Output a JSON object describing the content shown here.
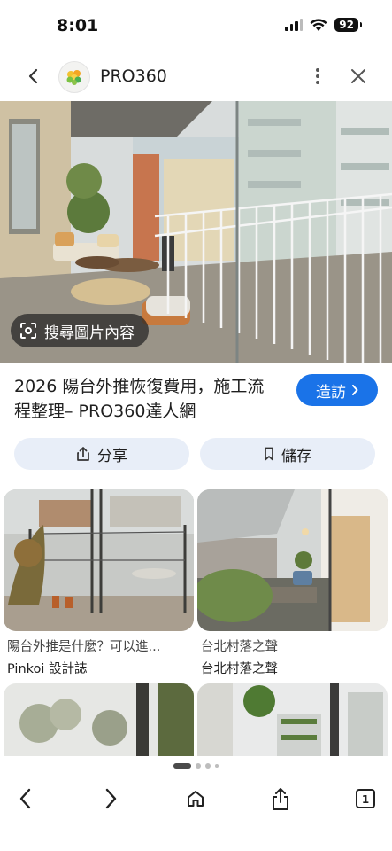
{
  "status": {
    "time": "8:01",
    "battery": "92"
  },
  "header": {
    "site_name": "PRO360"
  },
  "hero": {
    "lens_label": "搜尋圖片內容"
  },
  "result": {
    "title": "2026 陽台外推恢復費用，施工流程整理– PRO360達人網",
    "visit_label": "造訪"
  },
  "actions": {
    "share_label": "分享",
    "save_label": "儲存"
  },
  "related": [
    {
      "title": "陽台外推是什麼？可以進...",
      "source": "Pinkoi 設計誌"
    },
    {
      "title": "台北村落之聲",
      "source": "台北村落之聲"
    }
  ],
  "toolbar": {
    "tab_count": "1"
  }
}
